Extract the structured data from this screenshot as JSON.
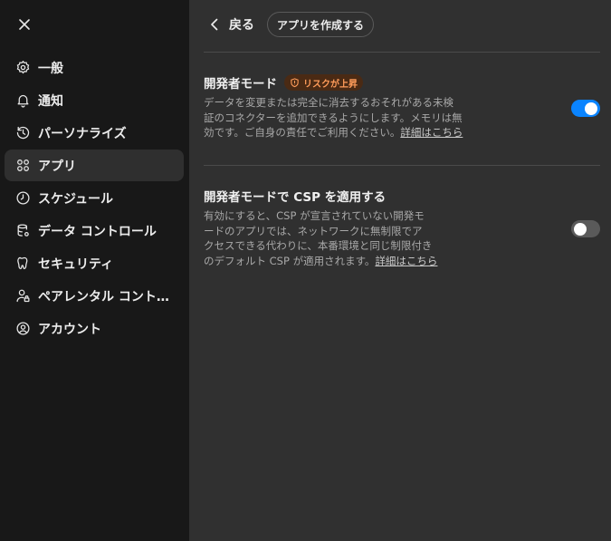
{
  "sidebar": {
    "close_icon": "close-icon",
    "items": [
      {
        "label": "一般",
        "icon": "gear-icon"
      },
      {
        "label": "通知",
        "icon": "bell-icon"
      },
      {
        "label": "パーソナライズ",
        "icon": "personalize-icon"
      },
      {
        "label": "アプリ",
        "icon": "apps-grid-icon"
      },
      {
        "label": "スケジュール",
        "icon": "clock-icon"
      },
      {
        "label": "データ コントロール",
        "icon": "database-icon"
      },
      {
        "label": "セキュリティ",
        "icon": "shield-icon"
      },
      {
        "label": "ペアレンタル コント…",
        "icon": "parental-icon"
      },
      {
        "label": "アカウント",
        "icon": "account-icon"
      }
    ],
    "active_index": 3
  },
  "header": {
    "back_label": "戻る",
    "create_app_label": "アプリを作成する"
  },
  "settings": {
    "developer_mode": {
      "title": "開発者モード",
      "badge": "リスクが上昇",
      "desc_lines": [
        "データを変更または完全に消去するおそれがある未検",
        "証のコネクターを追加できるようにします。メモリは無",
        "効です。ご自身の責任でご利用ください。"
      ],
      "link": "詳細はこちら",
      "enabled": true
    },
    "developer_csp": {
      "title": "開発者モードで CSP を適用する",
      "desc_lines": [
        "有効にすると、CSP が宣言されていない開発モ",
        "ードのアプリでは、ネットワークに無制限でア",
        "クセスできる代わりに、本番環境と同じ制限付き",
        "のデフォルト CSP が適用されます。"
      ],
      "link": "詳細はこちら",
      "enabled": false
    }
  },
  "colors": {
    "sidebar_bg": "#181818",
    "main_bg": "#303030",
    "toggle_on": "#0a84ff",
    "badge_text": "#ff9c5a"
  }
}
